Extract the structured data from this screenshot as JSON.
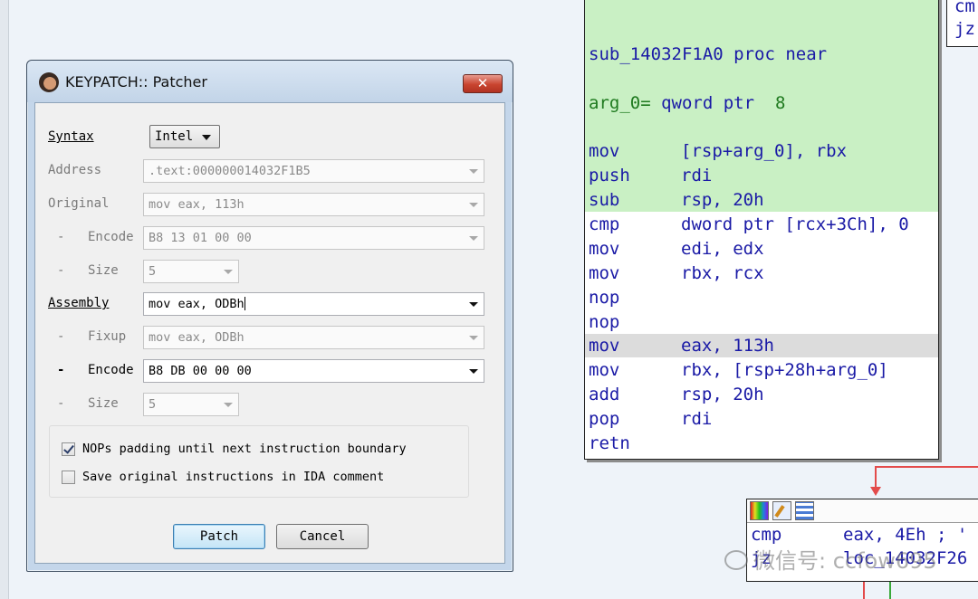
{
  "dialog": {
    "title": "KEYPATCH:: Patcher",
    "close_glyph": "✕",
    "syntax": {
      "label": "Syntax",
      "value": "Intel"
    },
    "address": {
      "label": "Address",
      "value": ".text:000000014032F1B5"
    },
    "original": {
      "label": "Original",
      "value": "mov eax, 113h"
    },
    "original_encode": {
      "label": "Encode",
      "value": "B8 13 01 00 00"
    },
    "original_size": {
      "label": "Size",
      "value": "5"
    },
    "assembly": {
      "label": "Assembly",
      "value": "mov eax, ODBh"
    },
    "fixup": {
      "label": "Fixup",
      "value": "mov eax, ODBh"
    },
    "new_encode": {
      "label": "Encode",
      "value": "B8 DB 00 00 00"
    },
    "new_size": {
      "label": "Size",
      "value": "5"
    },
    "dash": "-",
    "options": {
      "nop_padding": {
        "label": "NOPs padding until next instruction boundary",
        "checked": true
      },
      "save_comment": {
        "label": "Save original instructions in IDA comment",
        "checked": false
      }
    },
    "patch_label": "Patch",
    "cancel_label": "Cancel"
  },
  "ida": {
    "proc_header": {
      "name": "sub_14032F1A0",
      "kw": "proc near"
    },
    "arg_decl": {
      "name": "arg_0=",
      "type": "qword ptr",
      "value": "8"
    },
    "lines": [
      {
        "mn": "mov",
        "op": "[rsp+arg_0], rbx"
      },
      {
        "mn": "push",
        "op": "rdi"
      },
      {
        "mn": "sub",
        "op": "rsp, 20h"
      },
      {
        "mn": "cmp",
        "op": "dword ptr [rcx+3Ch], 0"
      },
      {
        "mn": "mov",
        "op": "edi, edx"
      },
      {
        "mn": "mov",
        "op": "rbx, rcx"
      },
      {
        "mn": "nop",
        "op": ""
      },
      {
        "mn": "nop",
        "op": ""
      },
      {
        "mn": "mov",
        "op": "eax, 113h"
      },
      {
        "mn": "mov",
        "op": "rbx, [rsp+28h+arg_0]"
      },
      {
        "mn": "add",
        "op": "rsp, 20h"
      },
      {
        "mn": "pop",
        "op": "rdi"
      },
      {
        "mn": "retn",
        "op": ""
      }
    ],
    "topright": [
      "cm",
      "jz"
    ],
    "block2": [
      {
        "mn": "cmp",
        "op": "eax, 4Eh ; '"
      },
      {
        "mn": "jz",
        "op": "loc_14032F26"
      }
    ]
  },
  "watermark": "微信号: ccfow695",
  "colors": {
    "ida_green": "#c9f0c4",
    "ida_text": "#1a1aa6",
    "highlight_row": "#dcdcdc",
    "edge_red": "#e34b4b",
    "edge_green": "#3aa83a"
  }
}
